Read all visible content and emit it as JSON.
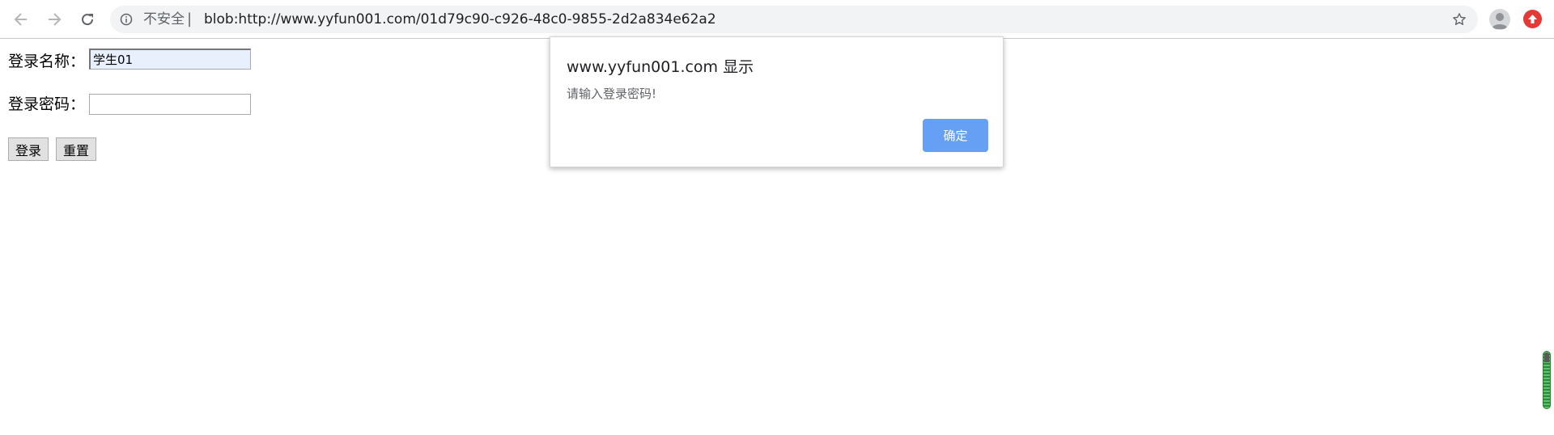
{
  "browser": {
    "security_label": "不安全",
    "separator": "|",
    "url": "blob:http://www.yyfun001.com/01d79c90-c926-48c0-9855-2d2a834e62a2",
    "icons": {
      "back": "arrow-left-icon",
      "forward": "arrow-right-icon",
      "reload": "reload-icon",
      "info": "info-circle-icon",
      "bookmark": "star-icon",
      "profile": "avatar-icon",
      "extension": "red-upload-icon"
    },
    "colors": {
      "omnibox_bg": "#f1f3f4",
      "extension_red": "#e53935"
    }
  },
  "login_form": {
    "username_label": "登录名称：",
    "username_value": "学生01",
    "password_label": "登录密码：",
    "password_value": "",
    "login_button": "登录",
    "reset_button": "重置"
  },
  "alert_dialog": {
    "title": "www.yyfun001.com 显示",
    "message": "请输入登录密码!",
    "ok_button": "确定",
    "ok_color": "#66a0f5"
  }
}
